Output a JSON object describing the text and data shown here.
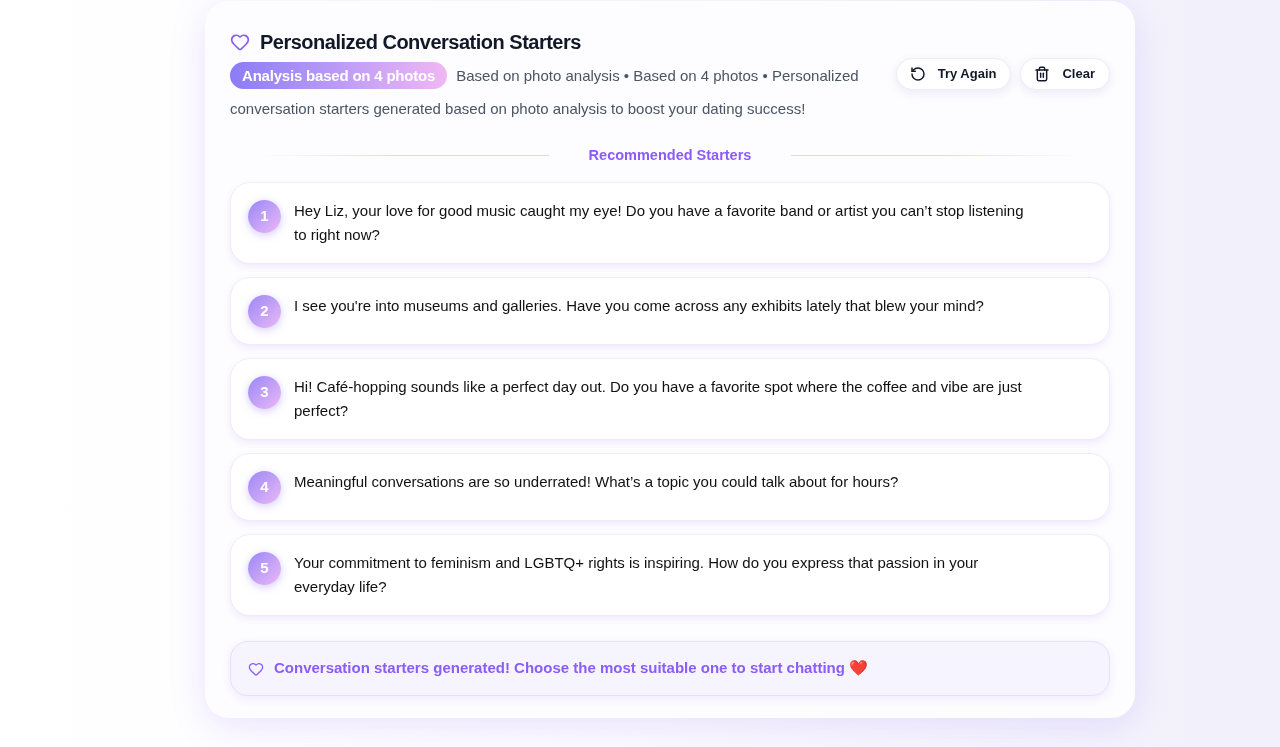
{
  "header": {
    "title": "Personalized Conversation Starters",
    "badge": "Analysis based on 4 photos",
    "description_lines": [
      "Based on photo analysis • Based on 4 photos • Personalized",
      "conversation starters generated based on photo analysis to boost your dating success!"
    ]
  },
  "actions": [
    {
      "kind": "retry",
      "label": "Try Again"
    },
    {
      "kind": "clear",
      "label": "Clear"
    }
  ],
  "section_title": "Recommended Starters",
  "starters": [
    {
      "number": "1",
      "text": "Hey Liz, your love for good music caught my eye! Do you have a favorite band or artist you can’t stop listening to right now?"
    },
    {
      "number": "2",
      "text": "I see you're into museums and galleries. Have you come across any exhibits lately that blew your mind?"
    },
    {
      "number": "3",
      "text": "Hi! Café-hopping sounds like a perfect day out. Do you have a favorite spot where the coffee and vibe are just perfect?"
    },
    {
      "number": "4",
      "text": "Meaningful conversations are so underrated! What’s a topic you could talk about for hours?"
    },
    {
      "number": "5",
      "text": "Your commitment to feminism and LGBTQ+ rights is inspiring. How do you express that passion in your everyday life?"
    }
  ],
  "footer": {
    "message": "Conversation starters generated! Choose the most suitable one to start chatting ❤️"
  }
}
